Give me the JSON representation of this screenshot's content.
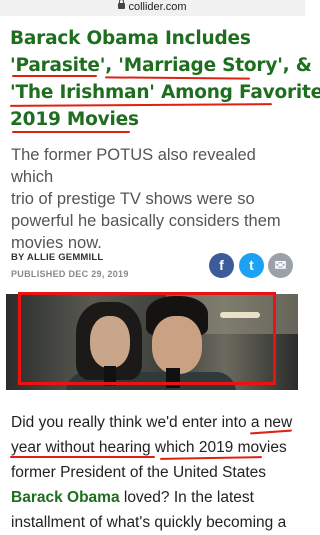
{
  "browser": {
    "url": "collider.com"
  },
  "article": {
    "headline_lines": [
      "Barack Obama Includes",
      "'Parasite', 'Marriage Story', &",
      "'The Irishman' Among Favorite",
      "2019 Movies"
    ],
    "dek_lines": [
      "The former POTUS also revealed which",
      "trio of prestige TV shows were so",
      "powerful he basically considers them",
      "movies now."
    ],
    "byline": "BY ALLIE GEMMILL",
    "published": "PUBLISHED DEC 29, 2019",
    "share": {
      "facebook": "f",
      "twitter": "t",
      "email": "✉"
    },
    "body": {
      "line1": "Did you really think we'd enter into a new",
      "line2": "year without hearing which 2019 movies",
      "line3": "former President of the United States",
      "line4_link": "Barack Obama",
      "line4_rest": " loved? In the latest",
      "line5": "installment of what's quickly becoming a"
    }
  },
  "colors": {
    "headline": "#1f6e1f",
    "annotation": "#e11111"
  }
}
